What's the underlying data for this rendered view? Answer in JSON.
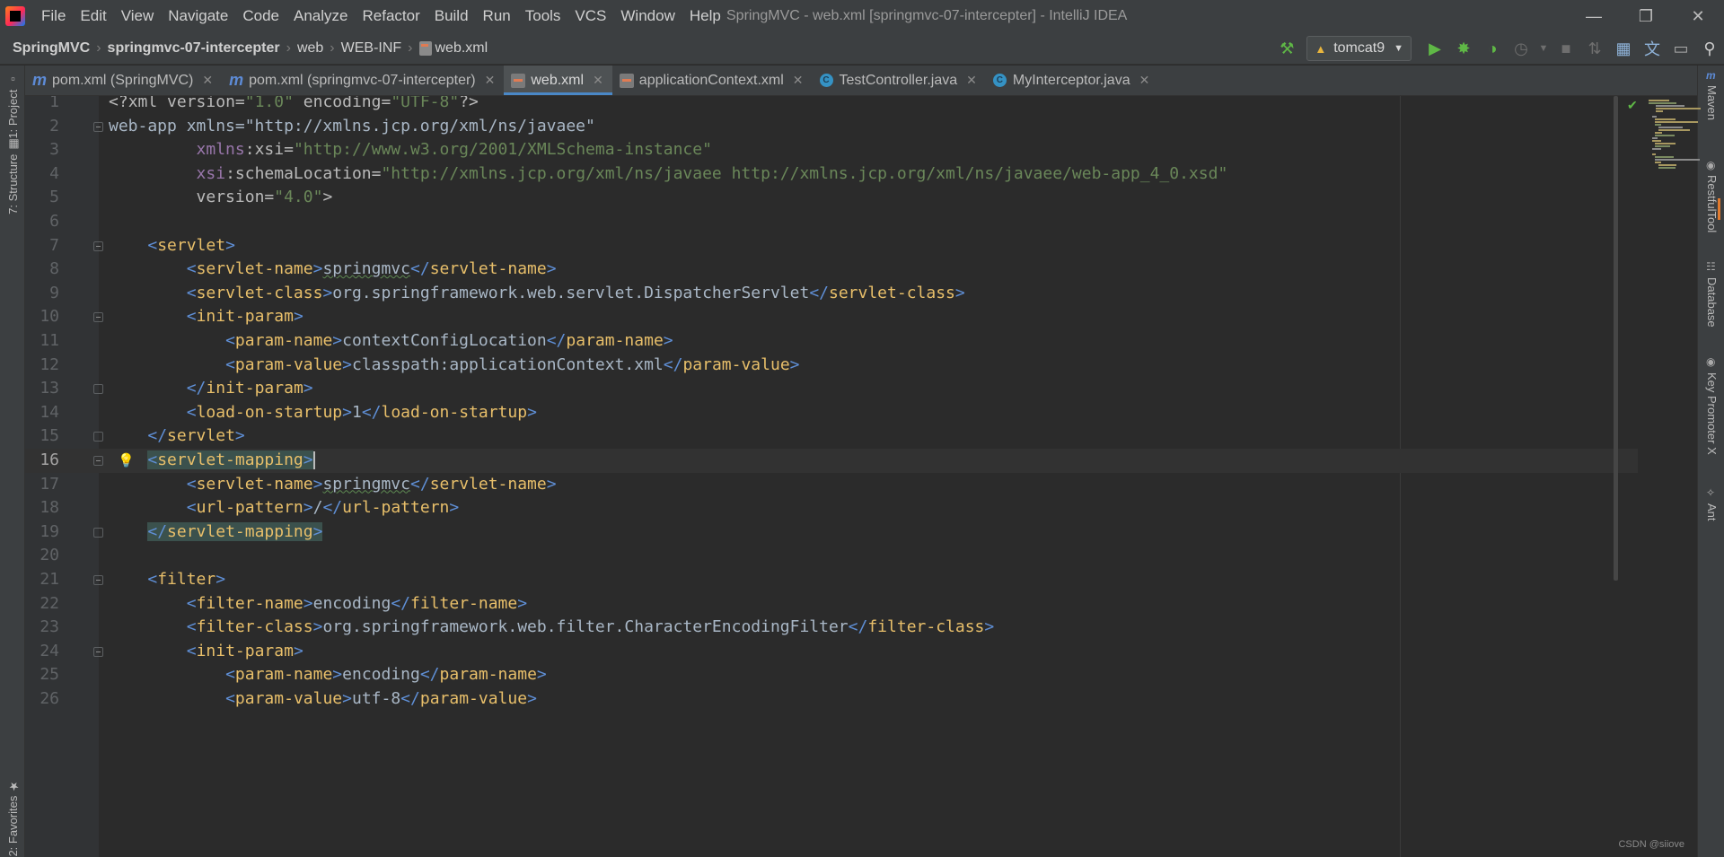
{
  "window": {
    "title": "SpringMVC - web.xml [springmvc-07-intercepter] - IntelliJ IDEA",
    "controls": [
      "minimize-icon",
      "restore-icon",
      "close-icon"
    ]
  },
  "menu": [
    "File",
    "Edit",
    "View",
    "Navigate",
    "Code",
    "Analyze",
    "Refactor",
    "Build",
    "Run",
    "Tools",
    "VCS",
    "Window",
    "Help"
  ],
  "breadcrumb": [
    "SpringMVC",
    "springmvc-07-intercepter",
    "web",
    "WEB-INF",
    "web.xml"
  ],
  "run_config": "tomcat9",
  "tabs": [
    {
      "label": "pom.xml (SpringMVC)",
      "icon": "maven-icon"
    },
    {
      "label": "pom.xml (springmvc-07-intercepter)",
      "icon": "maven-icon"
    },
    {
      "label": "web.xml",
      "icon": "xml-file-icon",
      "active": true
    },
    {
      "label": "applicationContext.xml",
      "icon": "xml-file-icon"
    },
    {
      "label": "TestController.java",
      "icon": "class-icon"
    },
    {
      "label": "MyInterceptor.java",
      "icon": "class-icon"
    }
  ],
  "left_tools": [
    "1: Project",
    "7: Structure",
    "2: Favorites"
  ],
  "right_tools": [
    "Maven",
    "RestfulTool",
    "Database",
    "Key Promoter X",
    "Ant"
  ],
  "current_line": 16,
  "code_lines": [
    "<?xml version=\"1.0\" encoding=\"UTF-8\"?>",
    "<web-app xmlns=\"http://xmlns.jcp.org/xml/ns/javaee\"",
    "         xmlns:xsi=\"http://www.w3.org/2001/XMLSchema-instance\"",
    "         xsi:schemaLocation=\"http://xmlns.jcp.org/xml/ns/javaee http://xmlns.jcp.org/xml/ns/javaee/web-app_4_0.xsd\"",
    "         version=\"4.0\">",
    "",
    "    <servlet>",
    "        <servlet-name>springmvc</servlet-name>",
    "        <servlet-class>org.springframework.web.servlet.DispatcherServlet</servlet-class>",
    "        <init-param>",
    "            <param-name>contextConfigLocation</param-name>",
    "            <param-value>classpath:applicationContext.xml</param-value>",
    "        </init-param>",
    "        <load-on-startup>1</load-on-startup>",
    "    </servlet>",
    "    <servlet-mapping>",
    "        <servlet-name>springmvc</servlet-name>",
    "        <url-pattern>/</url-pattern>",
    "    </servlet-mapping>",
    "",
    "    <filter>",
    "        <filter-name>encoding</filter-name>",
    "        <filter-class>org.springframework.web.filter.CharacterEncodingFilter</filter-class>",
    "        <init-param>",
    "            <param-name>encoding</param-name>",
    "            <param-value>utf-8</param-value>"
  ],
  "watermark": "CSDN @siiove"
}
